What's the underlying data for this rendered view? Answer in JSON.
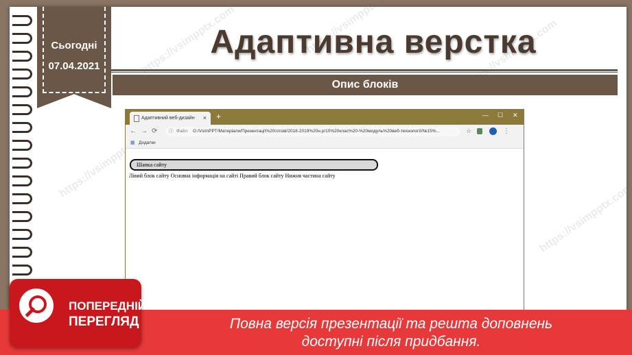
{
  "slide": {
    "today_label": "Сьогодні",
    "date": "07.04.2021",
    "title": "Адаптивна верстка",
    "subtitle": "Опис блоків"
  },
  "browser": {
    "tab_title": "Адаптивний веб-дизайн",
    "tab_close": "×",
    "new_tab": "+",
    "window_controls": {
      "minimize": "—",
      "maximize": "☐",
      "close": "✕"
    },
    "address": {
      "protocol_label": "Файл",
      "path": "G:/VsimPPT/Матеріали/Презентації%20готові/2018-2019%20н.р/10%20клас%20-%20модуль%20веб-технології/№15%..."
    },
    "bookmarks_label": "Додатки",
    "page": {
      "header_text": "Шапка сайту",
      "body_text": "Лівий блок сайту Основна інформація на сайті Правий блок сайту Нижня частина сайту"
    }
  },
  "watermark": "https://vsimpptx.com",
  "preview": {
    "line1": "ПОПЕРЕДНІЙ",
    "line2": "ПЕРЕГЛЯД"
  },
  "notice": {
    "line1": "Повна версія презентації та решта доповнень",
    "line2": "доступні після придбання."
  },
  "colors": {
    "brown": "#6b5747",
    "footer_red": "#e8393a",
    "badge_red": "#c9181d"
  }
}
